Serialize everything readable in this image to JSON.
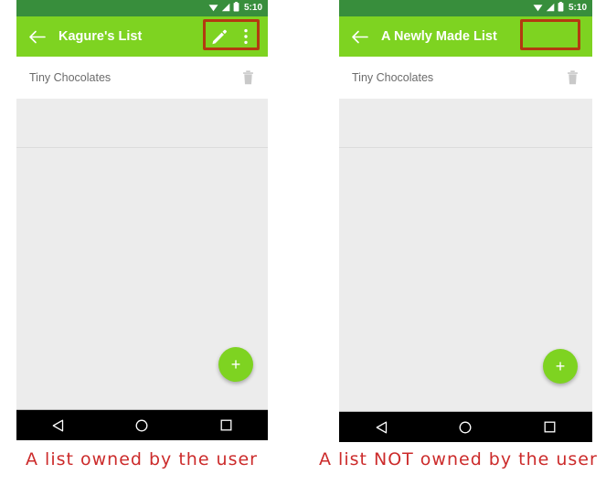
{
  "panels": [
    {
      "id": "owned",
      "status_bar": {
        "icons": [
          "wifi-icon",
          "signal-icon",
          "battery-icon"
        ],
        "clock": "5:10"
      },
      "app_bar": {
        "back_icon": "back-arrow-icon",
        "title": "Kagure's List",
        "actions": [
          {
            "icon": "edit-pencil-icon",
            "label": "Edit"
          },
          {
            "icon": "overflow-menu-icon",
            "label": "More options"
          }
        ],
        "highlight": {
          "visible": true,
          "color": "#b33a10",
          "contains_actions": true
        }
      },
      "list": {
        "items": [
          {
            "label": "Tiny Chocolates",
            "delete_icon": "trash-icon"
          }
        ]
      },
      "fab": {
        "icon": "plus-icon",
        "label": "+",
        "color": "#7ed321"
      },
      "nav_bar": {
        "buttons": [
          {
            "icon": "back-triangle-icon",
            "label": "Back"
          },
          {
            "icon": "home-circle-icon",
            "label": "Home"
          },
          {
            "icon": "recents-square-icon",
            "label": "Recents"
          }
        ]
      },
      "caption": "A list owned by the user"
    },
    {
      "id": "not-owned",
      "status_bar": {
        "icons": [
          "wifi-icon",
          "signal-icon",
          "battery-icon"
        ],
        "clock": "5:10"
      },
      "app_bar": {
        "back_icon": "back-arrow-icon",
        "title": "A Newly Made List",
        "actions": [],
        "highlight": {
          "visible": true,
          "color": "#b33a10",
          "contains_actions": false
        }
      },
      "list": {
        "items": [
          {
            "label": "Tiny Chocolates",
            "delete_icon": "trash-icon"
          }
        ]
      },
      "fab": {
        "icon": "plus-icon",
        "label": "+",
        "color": "#7ed321"
      },
      "nav_bar": {
        "buttons": [
          {
            "icon": "back-triangle-icon",
            "label": "Back"
          },
          {
            "icon": "home-circle-icon",
            "label": "Home"
          },
          {
            "icon": "recents-square-icon",
            "label": "Recents"
          }
        ]
      },
      "caption": "A list NOT owned by the user"
    }
  ],
  "theme": {
    "status_bar_green": "#388e3c",
    "app_bar_green": "#7ed321",
    "annotation_red": "#cc2b2b",
    "highlight_red": "#b33a10",
    "content_gray": "#ececec",
    "row_white": "#ffffff",
    "nav_black": "#000000"
  }
}
